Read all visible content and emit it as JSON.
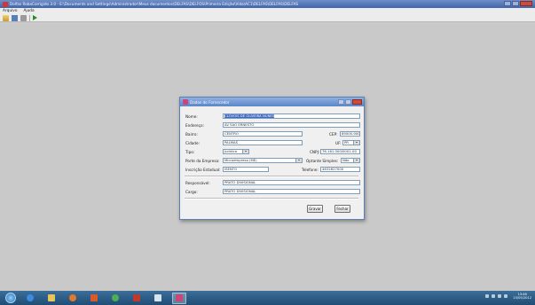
{
  "window": {
    "title": "Delfos RoboCorrigido 3.0 - E:\\Documents and Settings\\Administrador\\Meus documentos\\DELFAS\\DELFOS\\Primeira Edição\\Vida\\AC1\\DELFAS\\DELFAS\\DELFAS"
  },
  "menu": {
    "items": [
      "Arquivo",
      "Ajuda"
    ]
  },
  "dialog": {
    "title": "Dados do Fornecedor",
    "fields": {
      "nome": {
        "label": "Nome:",
        "value": "CLOVOIS DE OLIVEIRA NUNES"
      },
      "endereco": {
        "label": "Endereço:",
        "value": "AV SÃO ERNESTO"
      },
      "bairro": {
        "label": "Bairro:",
        "value": "CENTRO"
      },
      "cep": {
        "label": "CEP:",
        "value": "89000-000"
      },
      "cidade": {
        "label": "Cidade:",
        "value": "PALMAS"
      },
      "uf": {
        "label": "UF:",
        "value": "PR"
      },
      "tipo": {
        "label": "Tipo:",
        "value": "Jurídica"
      },
      "cnpj": {
        "label": "CNPJ:",
        "value": "76.161.000/0001-00"
      },
      "porte": {
        "label": "Porte da Empresa:",
        "value": "Microempresa (ME)"
      },
      "optante": {
        "label": "Optante Simples:",
        "value": "Não"
      },
      "inscricao": {
        "label": "Inscrição Estadual:",
        "value": "ISENTO"
      },
      "telefone": {
        "label": "Telefone:",
        "value": "4632627000"
      },
      "responsavel": {
        "label": "Responsável:",
        "value": "PRATO DIVISIONAL"
      },
      "cargo": {
        "label": "Cargo:",
        "value": "PRATO DIVISIONAL"
      }
    },
    "buttons": {
      "save": "Gravar",
      "close": "Fechar"
    }
  },
  "taskbar": {
    "clock_time": "13:46",
    "clock_date": "15/05/2012"
  },
  "colors": {
    "title_bar": "#3f65ad",
    "dialog_title_bar": "#5b86c9",
    "taskbar": "#1f4d74",
    "selection": "#3f68c8"
  }
}
